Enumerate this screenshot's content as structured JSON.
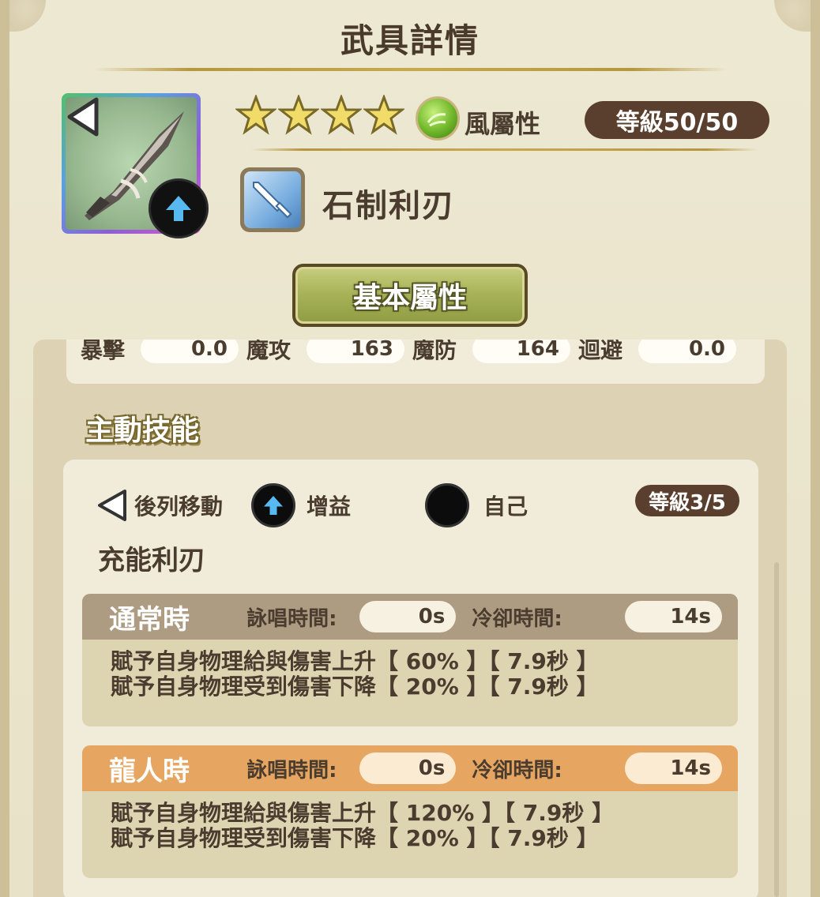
{
  "header": {
    "title": "武具詳情"
  },
  "weapon": {
    "stars": 4,
    "element_label": "風屬性",
    "level": "等級50/50",
    "name": "石制利刃",
    "icon": "dagger-icon",
    "type_icon": "sword-type-icon"
  },
  "tabs": {
    "basic_label": "基本屬性"
  },
  "stats": [
    {
      "label": "暴擊",
      "value": "0.0"
    },
    {
      "label": "魔攻",
      "value": "163"
    },
    {
      "label": "魔防",
      "value": "164"
    },
    {
      "label": "迴避",
      "value": "0.0"
    }
  ],
  "skill": {
    "section_title": "主動技能",
    "move_tag": "後列移動",
    "effect_tag": "增益",
    "target_tag": "自己",
    "level": "等級3/5",
    "name": "充能利刃",
    "modes": [
      {
        "name": "通常時",
        "cast_label": "詠唱時間:",
        "cast_value": "0s",
        "cooldown_label": "冷卻時間:",
        "cooldown_value": "14s",
        "desc_lines": [
          "賦予自身物理給與傷害上升【 60% 】【 7.9秒 】",
          "賦予自身物理受到傷害下降【 20% 】【 7.9秒 】"
        ]
      },
      {
        "name": "龍人時",
        "cast_label": "詠唱時間:",
        "cast_value": "0s",
        "cooldown_label": "冷卻時間:",
        "cooldown_value": "14s",
        "desc_lines": [
          "賦予自身物理給與傷害上升【 120% 】【 7.9秒 】",
          "賦予自身物理受到傷害下降【 20% 】【 7.9秒 】"
        ]
      }
    ]
  },
  "colors": {
    "level_pill": "#5a3f2e",
    "normal_header": "#ad9b82",
    "dragon_header": "#e6a560",
    "panel": "#ddd3b4"
  }
}
